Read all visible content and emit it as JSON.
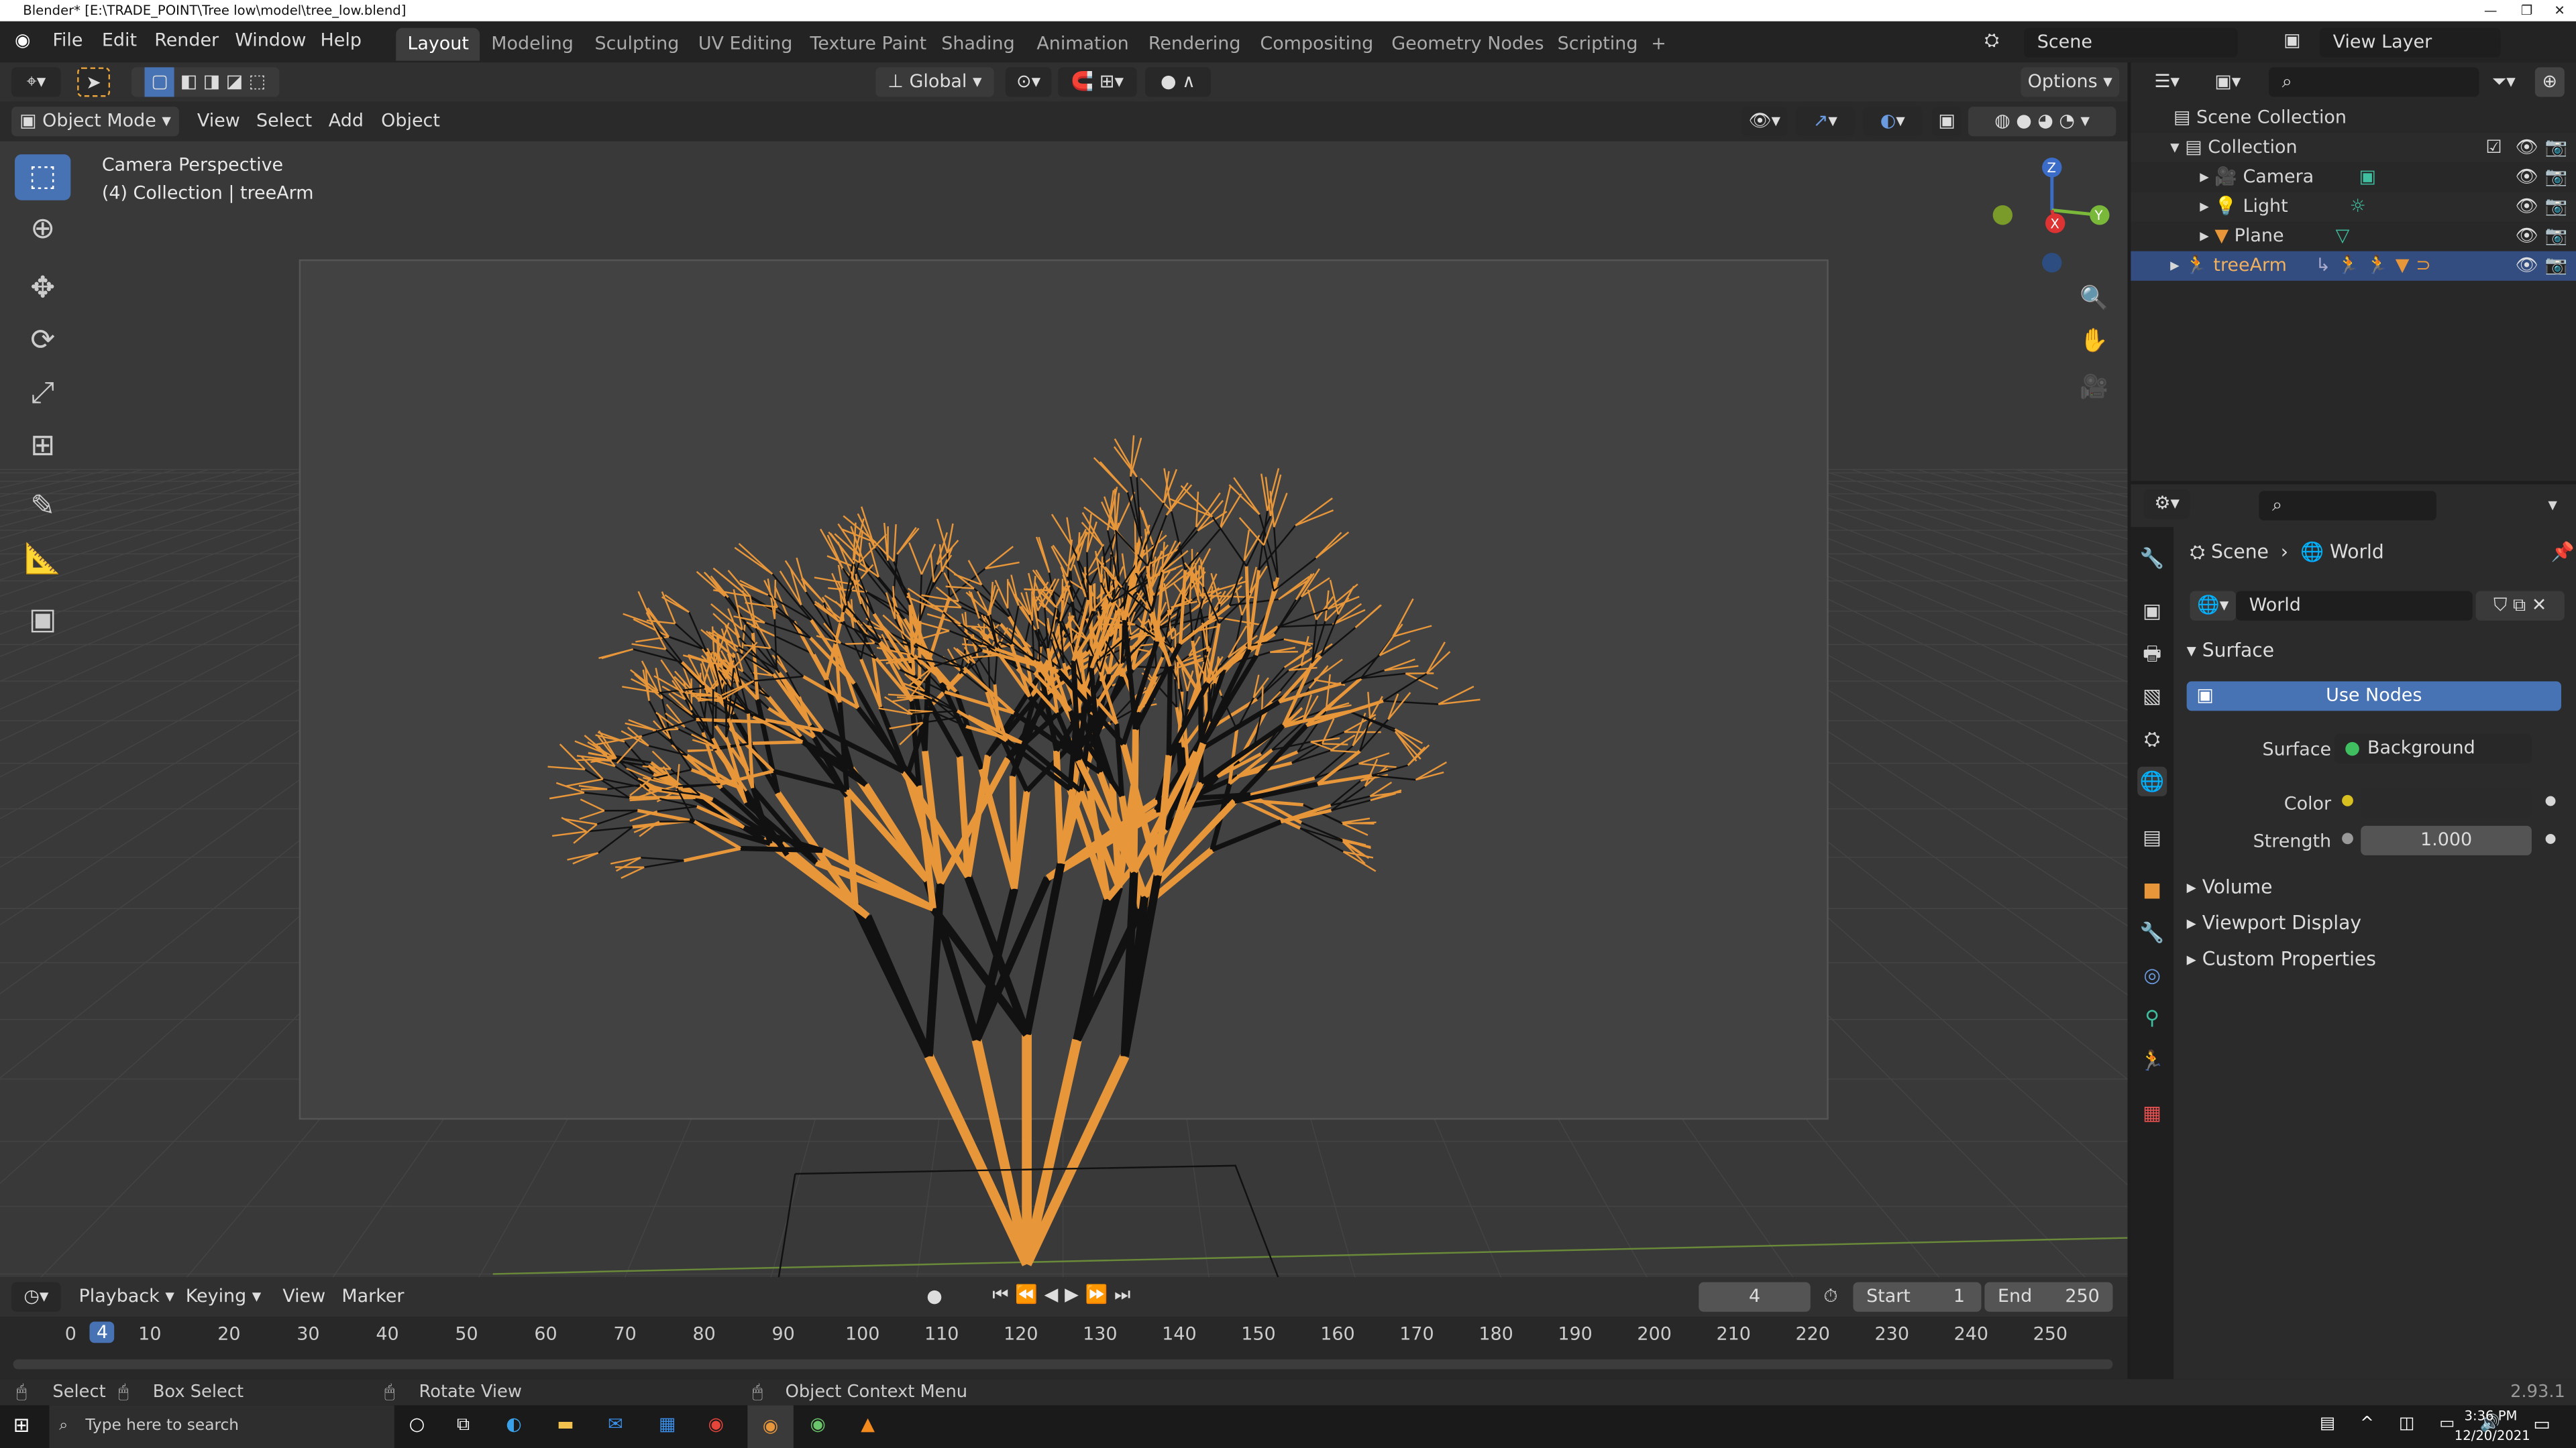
{
  "window": {
    "title": "Blender* [E:\\TRADE_POINT\\Tree low\\model\\tree_low.blend]",
    "minimize": "—",
    "maximize": "❐",
    "close": "✕"
  },
  "menu": [
    "File",
    "Edit",
    "Render",
    "Window",
    "Help"
  ],
  "workspaces": [
    "Layout",
    "Modeling",
    "Sculpting",
    "UV Editing",
    "Texture Paint",
    "Shading",
    "Animation",
    "Rendering",
    "Compositing",
    "Geometry Nodes",
    "Scripting",
    "+"
  ],
  "scene": {
    "name": "Scene",
    "view_layer": "View Layer"
  },
  "tool_header": {
    "orientation": "Global",
    "options": "Options"
  },
  "viewport_header": {
    "mode": "Object Mode",
    "menus": [
      "View",
      "Select",
      "Add",
      "Object"
    ]
  },
  "viewport": {
    "overlay_line1": "Camera Perspective",
    "overlay_line2": "(4) Collection | treeArm",
    "gizmo": {
      "x": "X",
      "y": "Y",
      "z": "Z"
    }
  },
  "timeline": {
    "menus": [
      "Playback",
      "Keying",
      "View",
      "Marker"
    ],
    "current_frame": "4",
    "start_label": "Start",
    "start": "1",
    "end_label": "End",
    "end": "250",
    "ticks": [
      "0",
      "10",
      "20",
      "30",
      "40",
      "50",
      "60",
      "70",
      "80",
      "90",
      "100",
      "110",
      "120",
      "130",
      "140",
      "150",
      "160",
      "170",
      "180",
      "190",
      "200",
      "210",
      "220",
      "230",
      "240",
      "250"
    ],
    "playhead": "4"
  },
  "status": {
    "select": "Select",
    "box_select": "Box Select",
    "rotate": "Rotate View",
    "context": "Object Context Menu",
    "version": "2.93.1"
  },
  "outliner": {
    "root": "Scene Collection",
    "collection": "Collection",
    "items": [
      "Camera",
      "Light",
      "Plane",
      "treeArm"
    ]
  },
  "properties": {
    "breadcrumb_scene": "Scene",
    "breadcrumb_world": "World",
    "world_name": "World",
    "surface_panel": "Surface",
    "use_nodes": "Use Nodes",
    "surface_label": "Surface",
    "surface_value": "Background",
    "color_label": "Color",
    "strength_label": "Strength",
    "strength_value": "1.000",
    "panels": [
      "Volume",
      "Viewport Display",
      "Custom Properties"
    ]
  },
  "taskbar": {
    "search_placeholder": "Type here to search",
    "time": "3:36 PM",
    "date": "12/20/2021"
  },
  "colors": {
    "accent": "#4772b3",
    "selected_row": "#334d80",
    "object_orange": "#e8963a",
    "data_green": "#3fbf9f"
  }
}
